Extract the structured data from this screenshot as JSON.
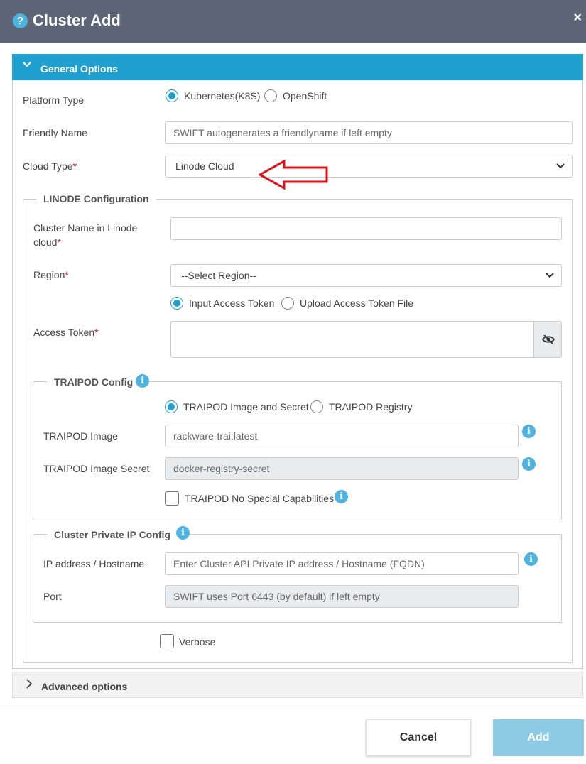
{
  "dialog": {
    "title": "Cluster Add"
  },
  "general": {
    "header": "General Options",
    "platform_type_label": "Platform Type",
    "platform_options": [
      "Kubernetes(K8S)",
      "OpenShift"
    ],
    "platform_selected": "Kubernetes(K8S)",
    "friendly_name_label": "Friendly Name",
    "friendly_name_placeholder": "SWIFT autogenerates a friendlyname if left empty",
    "cloud_type_label": "Cloud Type",
    "cloud_type_value": "Linode Cloud"
  },
  "linode": {
    "legend": "LINODE Configuration",
    "cluster_name_label_1": "Cluster Name in Linode",
    "cluster_name_label_2": "cloud",
    "cluster_name_value": "",
    "region_label": "Region",
    "region_value": "--Select Region--",
    "token_options": [
      "Input Access Token",
      "Upload Access Token File"
    ],
    "token_selected": "Input Access Token",
    "access_token_label": "Access Token",
    "access_token_value": ""
  },
  "traipod": {
    "legend": "TRAIPOD Config",
    "options": [
      "TRAIPOD Image and Secret",
      "TRAIPOD Registry"
    ],
    "selected": "TRAIPOD Image and Secret",
    "image_label": "TRAIPOD Image",
    "image_value": "rackware-trai:latest",
    "secret_label": "TRAIPOD Image Secret",
    "secret_value": "docker-registry-secret",
    "no_caps_label": "TRAIPOD No Special Capabilities",
    "no_caps_checked": false
  },
  "private_ip": {
    "legend": "Cluster Private IP Config",
    "ip_label": "IP address / Hostname",
    "ip_placeholder": "Enter Cluster API Private IP address / Hostname (FQDN)",
    "port_label": "Port",
    "port_placeholder": "SWIFT uses Port 6443 (by default) if left empty"
  },
  "verbose": {
    "label": "Verbose",
    "checked": false
  },
  "advanced": {
    "label": "Advanced options"
  },
  "footer": {
    "cancel_label": "Cancel",
    "add_label": "Add"
  },
  "required_mark": "*",
  "colors": {
    "title_bar": "#5c6575",
    "accent": "#1fa0cf",
    "annotation_arrow": "#e0101a",
    "add_button": "#8ccbe3"
  },
  "icons": {
    "help": "question-circle-icon",
    "close": "close-icon",
    "info": "info-circle-icon",
    "eye": "eye-slash-icon",
    "expand": "chevron-down-icon",
    "collapse": "chevron-right-icon"
  }
}
